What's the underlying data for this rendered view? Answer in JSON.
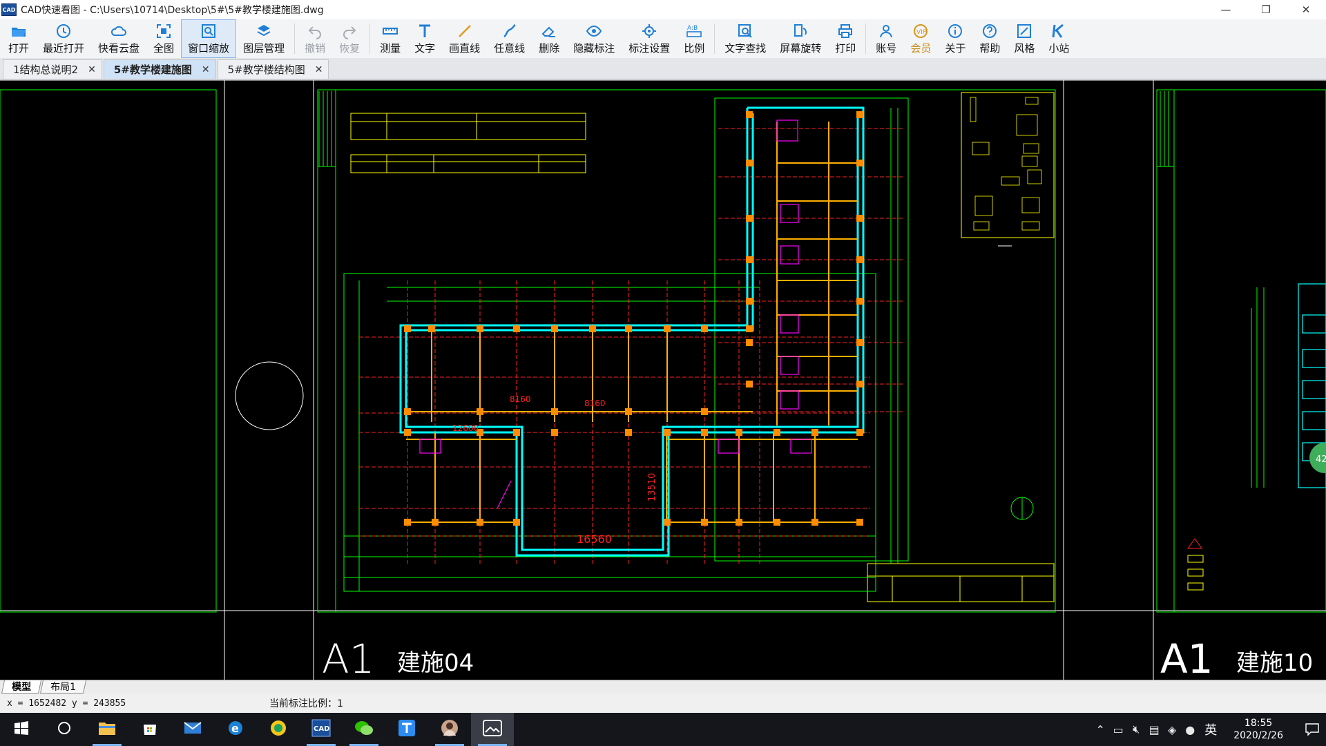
{
  "window": {
    "title": "CAD快速看图 - C:\\Users\\10714\\Desktop\\5#\\5#教学楼建施图.dwg",
    "app_icon_text": "CAD",
    "minimize": "—",
    "maximize": "❐",
    "close": "✕"
  },
  "toolbar": {
    "items": [
      {
        "label": "打开",
        "icon": "folder-open-icon"
      },
      {
        "label": "最近打开",
        "icon": "recent-clock-icon"
      },
      {
        "label": "快看云盘",
        "icon": "cloud-icon"
      },
      {
        "label": "全图",
        "icon": "fit-all-icon"
      },
      {
        "label": "窗口缩放",
        "icon": "window-zoom-icon",
        "active": true
      },
      {
        "label": "图层管理",
        "icon": "layers-icon"
      },
      {
        "label": "撤销",
        "icon": "undo-icon",
        "disabled": true
      },
      {
        "label": "恢复",
        "icon": "redo-icon",
        "disabled": true
      },
      {
        "label": "测量",
        "icon": "measure-icon"
      },
      {
        "label": "文字",
        "icon": "text-icon"
      },
      {
        "label": "画直线",
        "icon": "line-icon"
      },
      {
        "label": "任意线",
        "icon": "freehand-icon"
      },
      {
        "label": "删除",
        "icon": "eraser-icon"
      },
      {
        "label": "隐藏标注",
        "icon": "eye-icon"
      },
      {
        "label": "标注设置",
        "icon": "markup-settings-icon"
      },
      {
        "label": "比例",
        "icon": "scale-icon"
      },
      {
        "label": "文字查找",
        "icon": "text-search-icon"
      },
      {
        "label": "屏幕旋转",
        "icon": "rotate-screen-icon"
      },
      {
        "label": "打印",
        "icon": "printer-icon"
      },
      {
        "label": "账号",
        "icon": "user-icon"
      },
      {
        "label": "会员",
        "icon": "vip-icon",
        "gold": true
      },
      {
        "label": "关于",
        "icon": "info-icon"
      },
      {
        "label": "帮助",
        "icon": "help-icon"
      },
      {
        "label": "风格",
        "icon": "style-icon"
      },
      {
        "label": "小站",
        "icon": "k-station-icon"
      }
    ]
  },
  "tabs": [
    {
      "label": "1结构总说明2",
      "close": "✕",
      "active": false
    },
    {
      "label": "5#教学楼建施图",
      "close": "✕",
      "active": true
    },
    {
      "label": "5#教学楼结构图",
      "close": "✕",
      "active": false
    }
  ],
  "drawing": {
    "sheet1_size": "A1",
    "sheet1_number": "建施04",
    "sheet2_size": "A1",
    "sheet2_number": "建施10",
    "dim_8160": "8160",
    "dim_8160b": "8160",
    "dim_16560": "16560",
    "dim_13510": "13510",
    "dim_12600": "12600",
    "badge_42": "42",
    "colors": {
      "frame": "#00ff00",
      "wall": "#00ffff",
      "column": "#ff8c00",
      "axis": "#ff2020",
      "text": "#ffffff",
      "yellow": "#ffff00",
      "magenta": "#ff00ff"
    }
  },
  "layout_tabs": [
    {
      "label": "模型",
      "active": true
    },
    {
      "label": "布局1",
      "active": false
    }
  ],
  "status": {
    "coords": "x = 1652482  y = 243855",
    "scale_label": "当前标注比例：1"
  },
  "taskbar": {
    "apps": [
      "windows-start-icon",
      "search-circle-icon",
      "file-explorer-icon",
      "store-icon",
      "mail-icon",
      "edge-icon",
      "browser-icon",
      "cad-viewer-icon",
      "wechat-icon",
      "t-app-icon",
      "avatar-app-icon",
      "photos-icon"
    ],
    "ime": "英",
    "time": "18:55",
    "date": "2020/2/26"
  }
}
